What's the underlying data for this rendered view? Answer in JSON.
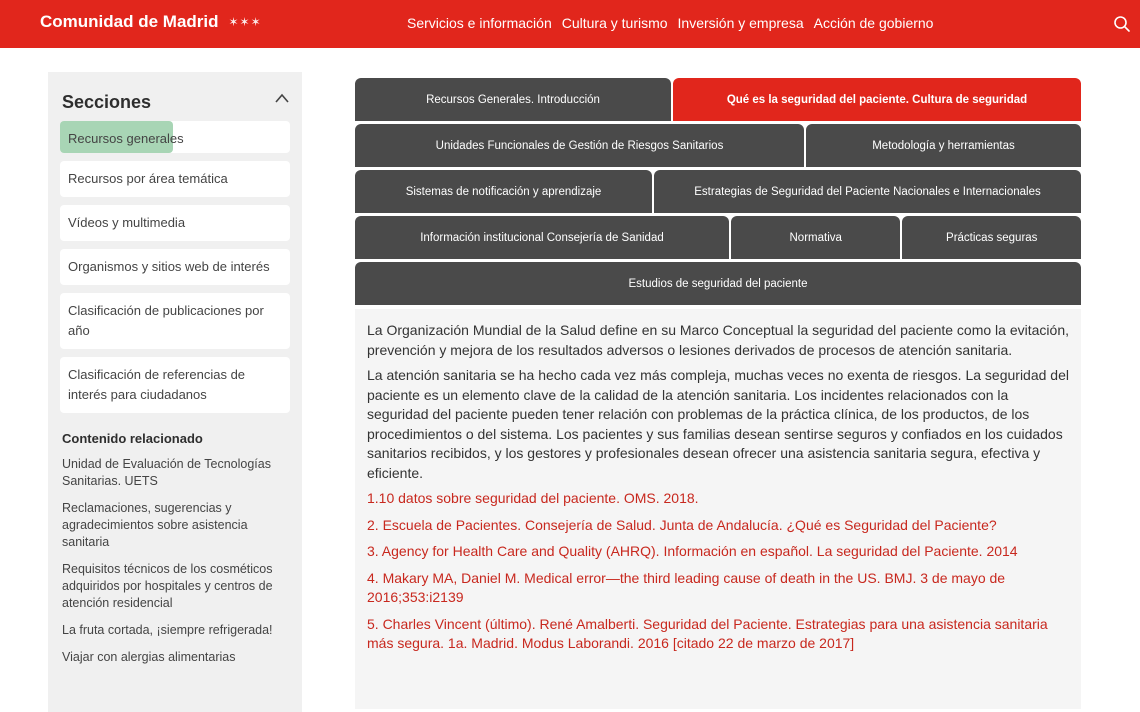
{
  "header": {
    "brand": "Comunidad de Madrid",
    "brand_mark": "✶✶✶",
    "nav": [
      {
        "label": "Servicios e información"
      },
      {
        "label": "Cultura y turismo"
      },
      {
        "label": "Inversión y empresa"
      },
      {
        "label": "Acción de gobierno"
      }
    ],
    "search_icon": "search-icon"
  },
  "sidebar": {
    "title": "Secciones",
    "sections": [
      {
        "label": "Recursos generales",
        "active": true
      },
      {
        "label": "Recursos por área temática"
      },
      {
        "label": "Vídeos y multimedia"
      },
      {
        "label": "Organismos y sitios web de interés"
      },
      {
        "label": "Clasificación de publicaciones por año"
      },
      {
        "label": "Clasificación de referencias de interés para ciudadanos"
      }
    ],
    "related_title": "Contenido relacionado",
    "related": [
      {
        "label": "Unidad de Evaluación de Tecnologías Sanitarias. UETS"
      },
      {
        "label": "Reclamaciones, sugerencias y agradecimientos sobre asistencia sanitaria"
      },
      {
        "label": "Requisitos técnicos de los cosméticos adquiridos por hospitales y centros de atención residencial"
      },
      {
        "label": "La fruta cortada, ¡siempre refrigerada!"
      },
      {
        "label": "Viajar con alergias alimentarias"
      }
    ]
  },
  "tabs": {
    "rows": [
      [
        {
          "label": "Recursos Generales. Introducción"
        },
        {
          "label": "Qué es la seguridad del paciente. Cultura de seguridad",
          "active": true
        }
      ],
      [
        {
          "label": "Unidades Funcionales de Gestión de Riesgos Sanitarios"
        },
        {
          "label": "Metodología y herramientas"
        }
      ],
      [
        {
          "label": "Sistemas de notificación y aprendizaje"
        },
        {
          "label": "Estrategias de Seguridad del Paciente Nacionales e Internacionales"
        }
      ],
      [
        {
          "label": "Información institucional Consejería de Sanidad"
        },
        {
          "label": "Normativa"
        },
        {
          "label": "Prácticas seguras"
        }
      ],
      [
        {
          "label": "Estudios de seguridad del paciente"
        }
      ]
    ]
  },
  "content": {
    "paragraphs": [
      "La Organización Mundial de la Salud define en su Marco Conceptual la seguridad del paciente como la evitación, prevención y mejora de los resultados adversos o lesiones derivados de procesos de atención sanitaria.",
      "La atención sanitaria se ha hecho cada vez más compleja, muchas veces no exenta de riesgos. La seguridad del paciente es un elemento clave de la calidad de la atención sanitaria. Los incidentes relacionados con la seguridad del paciente pueden tener relación con problemas de la práctica clínica, de los productos, de los procedimientos o del sistema. Los pacientes y sus familias desean sentirse seguros y confiados en los cuidados sanitarios recibidos, y los gestores y profesionales desean ofrecer una asistencia sanitaria segura, efectiva y eficiente."
    ],
    "references": [
      "1.10 datos sobre seguridad del paciente. OMS. 2018.",
      "2. Escuela de Pacientes. Consejería de Salud. Junta de Andalucía. ¿Qué es Seguridad del Paciente?",
      "3. Agency for Health Care and Quality (AHRQ). Información en español. La seguridad del Paciente. 2014",
      "4. Makary MA, Daniel M. Medical error—the third leading cause of death in the US. BMJ. 3 de mayo de 2016;353:i2139",
      "5. Charles Vincent (último). René Amalberti. Seguridad del Paciente. Estrategias para una asistencia sanitaria más segura. 1a. Madrid. Modus Laborandi. 2016 [citado 22 de marzo de 2017]"
    ]
  },
  "colors": {
    "brand_red": "#e1261c",
    "tab_dark": "#4a4a4a",
    "highlight_green": "#a8d5b5",
    "link_red": "#c8281e"
  }
}
